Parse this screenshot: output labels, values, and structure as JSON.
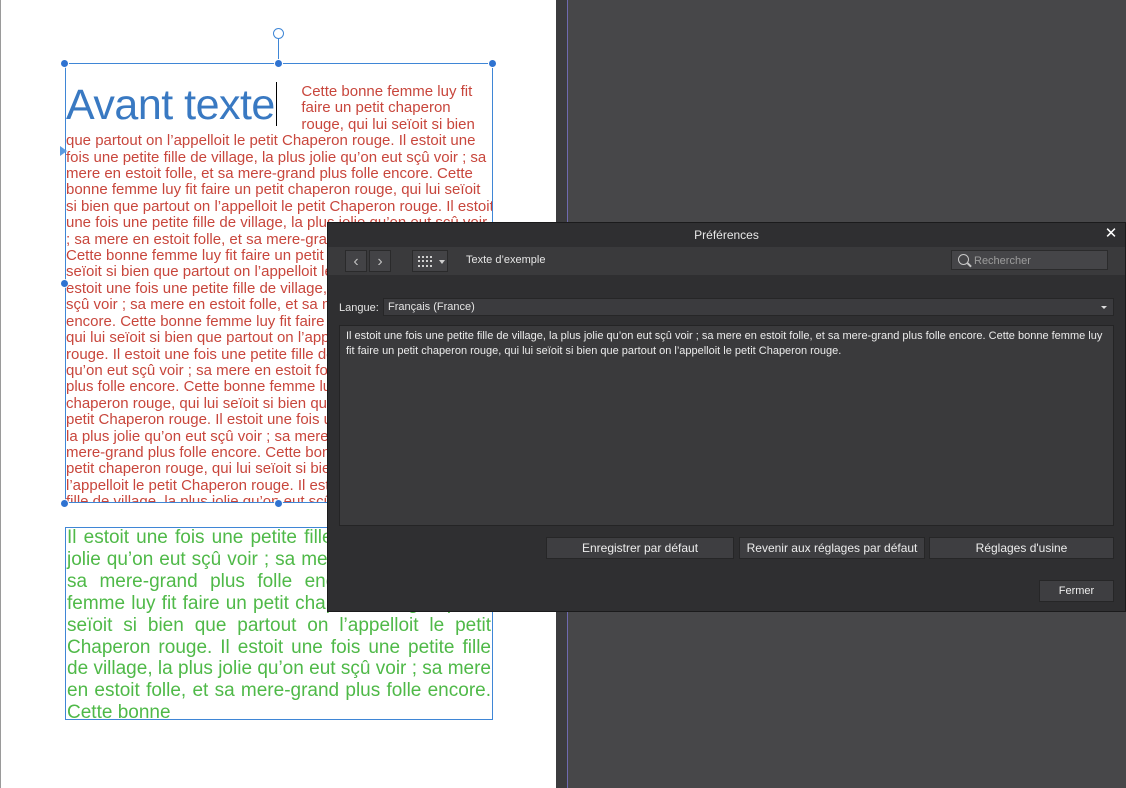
{
  "document": {
    "headline": "Avant texte",
    "frame1_text": "Cette bonne femme luy fit faire un petit chaperon rouge, qui lui seïoit si bien que partout on l’appelloit le petit Chaperon rouge. Il estoit une fois une petite fille de village, la plus jolie qu’on eut sçû voir ; sa mere en estoit folle, et sa mere-grand plus folle encore. Cette bonne femme luy fit faire un petit chaperon rouge, qui lui seïoit si bien que partout on l’appelloit le petit Chaperon rouge. Il estoit une fois une petite fille de village, la plus jolie qu’on eut sçû voir ; sa mere en estoit folle, et sa mere-grand plus folle encore. Cette bonne femme luy fit faire un petit chaperon rouge, qui lui seïoit si bien que partout on l’appelloit le petit Chaperon rouge. Il estoit une fois une petite fille de village, la plus jolie qu’on eut sçû voir ; sa mere en estoit folle, et sa mere-grand plus folle encore. Cette bonne femme luy fit faire un petit chaperon rouge, qui lui seïoit si bien que partout on l’appelloit le petit Chaperon rouge. Il estoit une fois une petite fille de village, la plus jolie qu’on eut sçû voir ; sa mere en estoit folle, et sa mere-grand plus folle encore. Cette bonne femme luy fit faire un petit chaperon rouge, qui lui seïoit si bien que partout on l’appelloit le petit Chaperon rouge. Il estoit une fois une petite fille de village, la plus jolie qu’on eut sçû voir ; sa mere en estoit folle, et sa mere-grand plus folle encore. Cette bonne femme luy fit faire un petit chaperon rouge, qui lui seïoit si bien que partout on l’appelloit le petit Chaperon rouge. Il estoit une fois une petite fille de village, la plus jolie qu’on eut sçû voir ; sa mere en estoit folle, et sa mere-grand plus folle encore. Cette bonne femme luy fit faire un petit chaperon rouge",
    "frame2_text": "Il estoit une fois une petite fille de village, la plus jolie qu’on eut sçû voir ; sa mere en estoit folle, et sa mere-grand plus folle encore. Cette bonne femme luy fit faire un petit chaperon rouge, qui lui seïoit si bien que partout on l’appelloit le petit Chaperon rouge. Il estoit une fois une petite fille de village, la plus jolie qu’on eut sçû voir ; sa mere en estoit folle, et sa mere-grand plus folle encore. Cette bonne",
    "colors": {
      "headline": "#3979c2",
      "frame1_text": "#c8463c",
      "frame2_text": "#4fb948",
      "selection": "#3f86d6"
    }
  },
  "dialog": {
    "title": "Préférences",
    "close_glyph": "✕",
    "nav_back_glyph": "‹",
    "nav_forward_glyph": "›",
    "section_title": "Texte d’exemple",
    "search_placeholder": "Rechercher",
    "language_label": "Langue:",
    "language_value": "Français (France)",
    "sample_text": "Il estoit une fois une petite fille de village, la plus jolie qu’on eut sçû voir ; sa mere en estoit folle, et sa mere-grand plus folle encore. Cette bonne femme luy fit faire un petit chaperon rouge, qui lui seïoit si bien que partout on l’appelloit le petit Chaperon rouge.",
    "buttons": {
      "save_default": "Enregistrer par défaut",
      "revert_default": "Revenir aux réglages par défaut",
      "factory": "Réglages d'usine",
      "close": "Fermer"
    }
  }
}
